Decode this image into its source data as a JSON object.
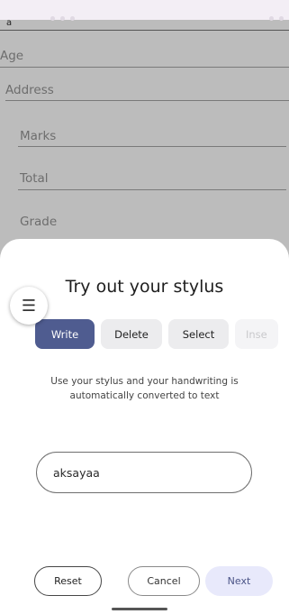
{
  "background_form": {
    "top_value": "a",
    "fields": [
      {
        "label": "Age"
      },
      {
        "label": "Address"
      },
      {
        "label": "Marks"
      },
      {
        "label": "Total"
      },
      {
        "label": "Grade"
      }
    ]
  },
  "sheet": {
    "title": "Try out your stylus",
    "menu_icon": "☰",
    "tabs": [
      {
        "label": "Write",
        "active": true
      },
      {
        "label": "Delete",
        "active": false
      },
      {
        "label": "Select",
        "active": false
      },
      {
        "label": "Inse",
        "active": false
      }
    ],
    "description": "Use your stylus and your handwriting is automatically converted to text",
    "input_value": "aksayaa",
    "buttons": {
      "reset": "Reset",
      "cancel": "Cancel",
      "next": "Next"
    }
  },
  "colors": {
    "accent": "#4f5c90",
    "next_button_bg": "#e8e9fb",
    "scrim": "#bcbcbc"
  }
}
